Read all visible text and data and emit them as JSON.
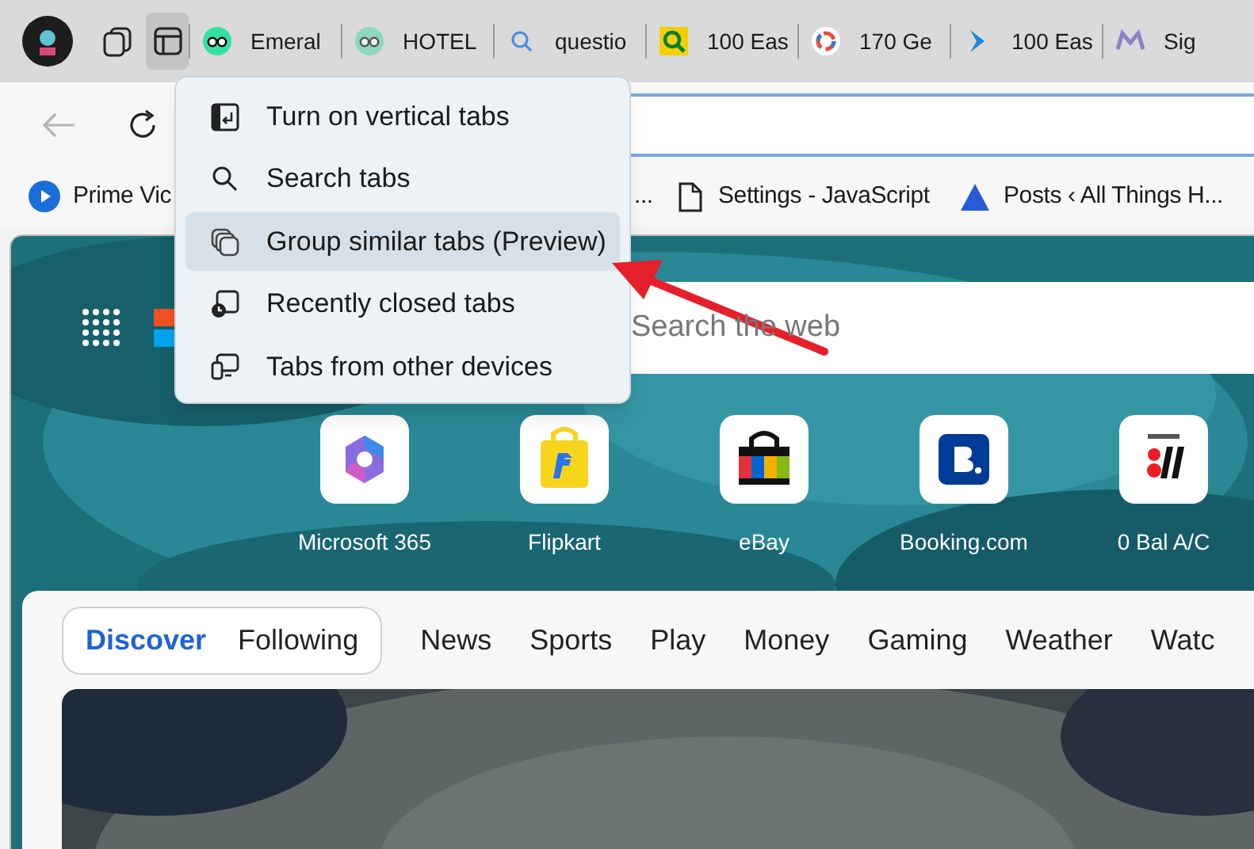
{
  "tab_strip": {
    "tab_actions_expanded": true,
    "tabs": [
      {
        "title": "Emeral"
      },
      {
        "title": "HOTEL"
      },
      {
        "title": "questio"
      },
      {
        "title": "100 Eas"
      },
      {
        "title": "170 Ge"
      },
      {
        "title": "100 Eas"
      },
      {
        "title": "Sig"
      }
    ]
  },
  "favorites": [
    {
      "title": "Prime Vic"
    },
    {
      "title": "..."
    },
    {
      "title": "Settings - JavaScript"
    },
    {
      "title": "Posts ‹ All Things H..."
    }
  ],
  "tab_actions_menu": [
    {
      "label": "Turn on vertical tabs",
      "selected": false
    },
    {
      "label": "Search tabs",
      "selected": false
    },
    {
      "label": "Group similar tabs (Preview)",
      "selected": true
    },
    {
      "label": "Recently closed tabs",
      "selected": false
    },
    {
      "label": "Tabs from other devices",
      "selected": false
    }
  ],
  "search": {
    "placeholder": "Search the web"
  },
  "quick_links": [
    {
      "label": "Microsoft 365"
    },
    {
      "label": "Flipkart"
    },
    {
      "label": "eBay"
    },
    {
      "label": "Booking.com"
    },
    {
      "label": "0 Bal A/C"
    }
  ],
  "feed_nav": {
    "pills": [
      {
        "label": "Discover",
        "selected": true
      },
      {
        "label": "Following",
        "selected": false
      }
    ],
    "links": [
      "News",
      "Sports",
      "Play",
      "Money",
      "Gaming",
      "Weather",
      "Watc"
    ]
  }
}
